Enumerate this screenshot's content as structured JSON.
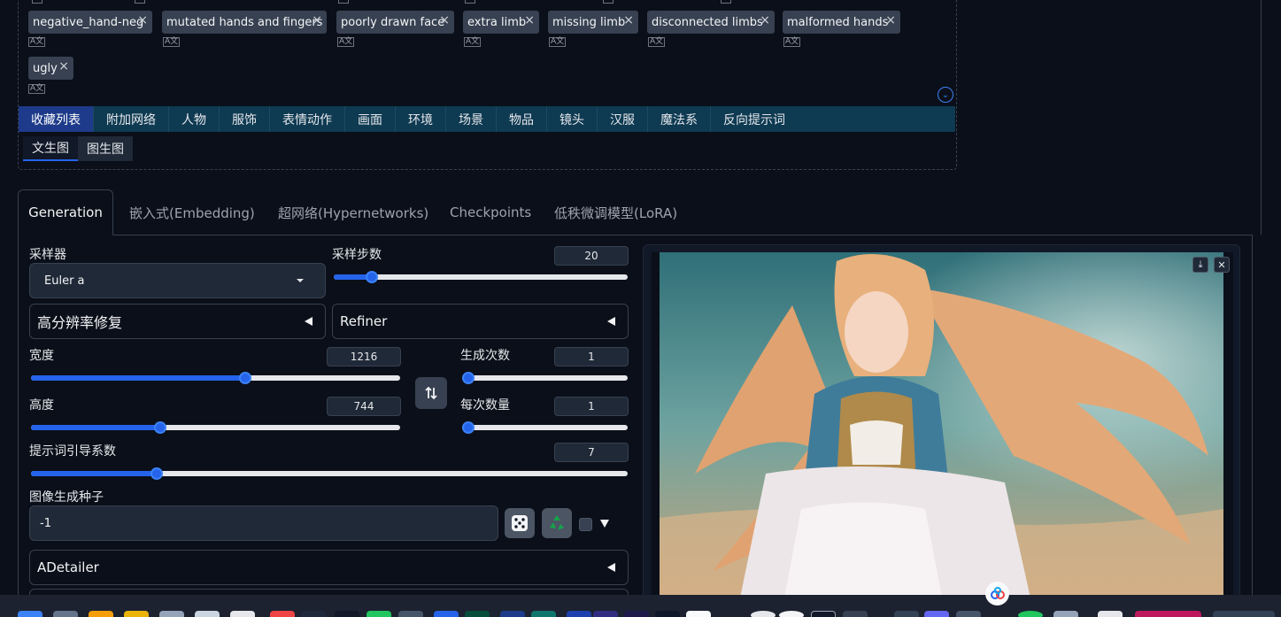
{
  "negative_tags": {
    "items": [
      {
        "label": "negative_hand-neg"
      },
      {
        "label": "mutated hands and fingers"
      },
      {
        "label": "poorly drawn face"
      },
      {
        "label": "extra limb"
      },
      {
        "label": "missing limb"
      },
      {
        "label": "disconnected limbs"
      },
      {
        "label": "malformed hands"
      },
      {
        "label": "ugly"
      }
    ],
    "remove_glyph": "×",
    "translate_glyph": "A文"
  },
  "category_tabs": [
    "收藏列表",
    "附加网络",
    "人物",
    "服饰",
    "表情动作",
    "画面",
    "环境",
    "场景",
    "物品",
    "镜头",
    "汉服",
    "魔法系",
    "反向提示词"
  ],
  "sub_tabs": [
    "文生图",
    "图生图"
  ],
  "main_tabs": [
    "Generation",
    "嵌入式(Embedding)",
    "超网络(Hypernetworks)",
    "Checkpoints",
    "低秩微调模型(LoRA)"
  ],
  "generation": {
    "sampler_label": "采样器",
    "sampler_value": "Euler a",
    "steps_label": "采样步数",
    "steps_value": "20",
    "steps_fraction": 0.13,
    "hires_label": "高分辨率修复",
    "refiner_label": "Refiner",
    "width_label": "宽度",
    "width_value": "1216",
    "width_fraction": 0.58,
    "height_label": "高度",
    "height_value": "744",
    "height_fraction": 0.35,
    "batch_count_label": "生成次数",
    "batch_count_value": "1",
    "batch_count_fraction": 0.0,
    "batch_size_label": "每次数量",
    "batch_size_value": "1",
    "batch_size_fraction": 0.0,
    "cfg_label": "提示词引导系数",
    "cfg_value": "7",
    "cfg_fraction": 0.21,
    "seed_label": "图像生成种子",
    "seed_value": "-1",
    "adetailer_label": "ADetailer"
  },
  "colors": {
    "accent": "#2563eb",
    "background": "#0b0f19",
    "panel": "#1f2937",
    "category_bar": "#0e3a52"
  },
  "icons": {
    "swap": "swap-icon",
    "dice": "dice-icon",
    "recycle": "recycle-icon",
    "download": "download-icon",
    "close": "close-icon"
  }
}
